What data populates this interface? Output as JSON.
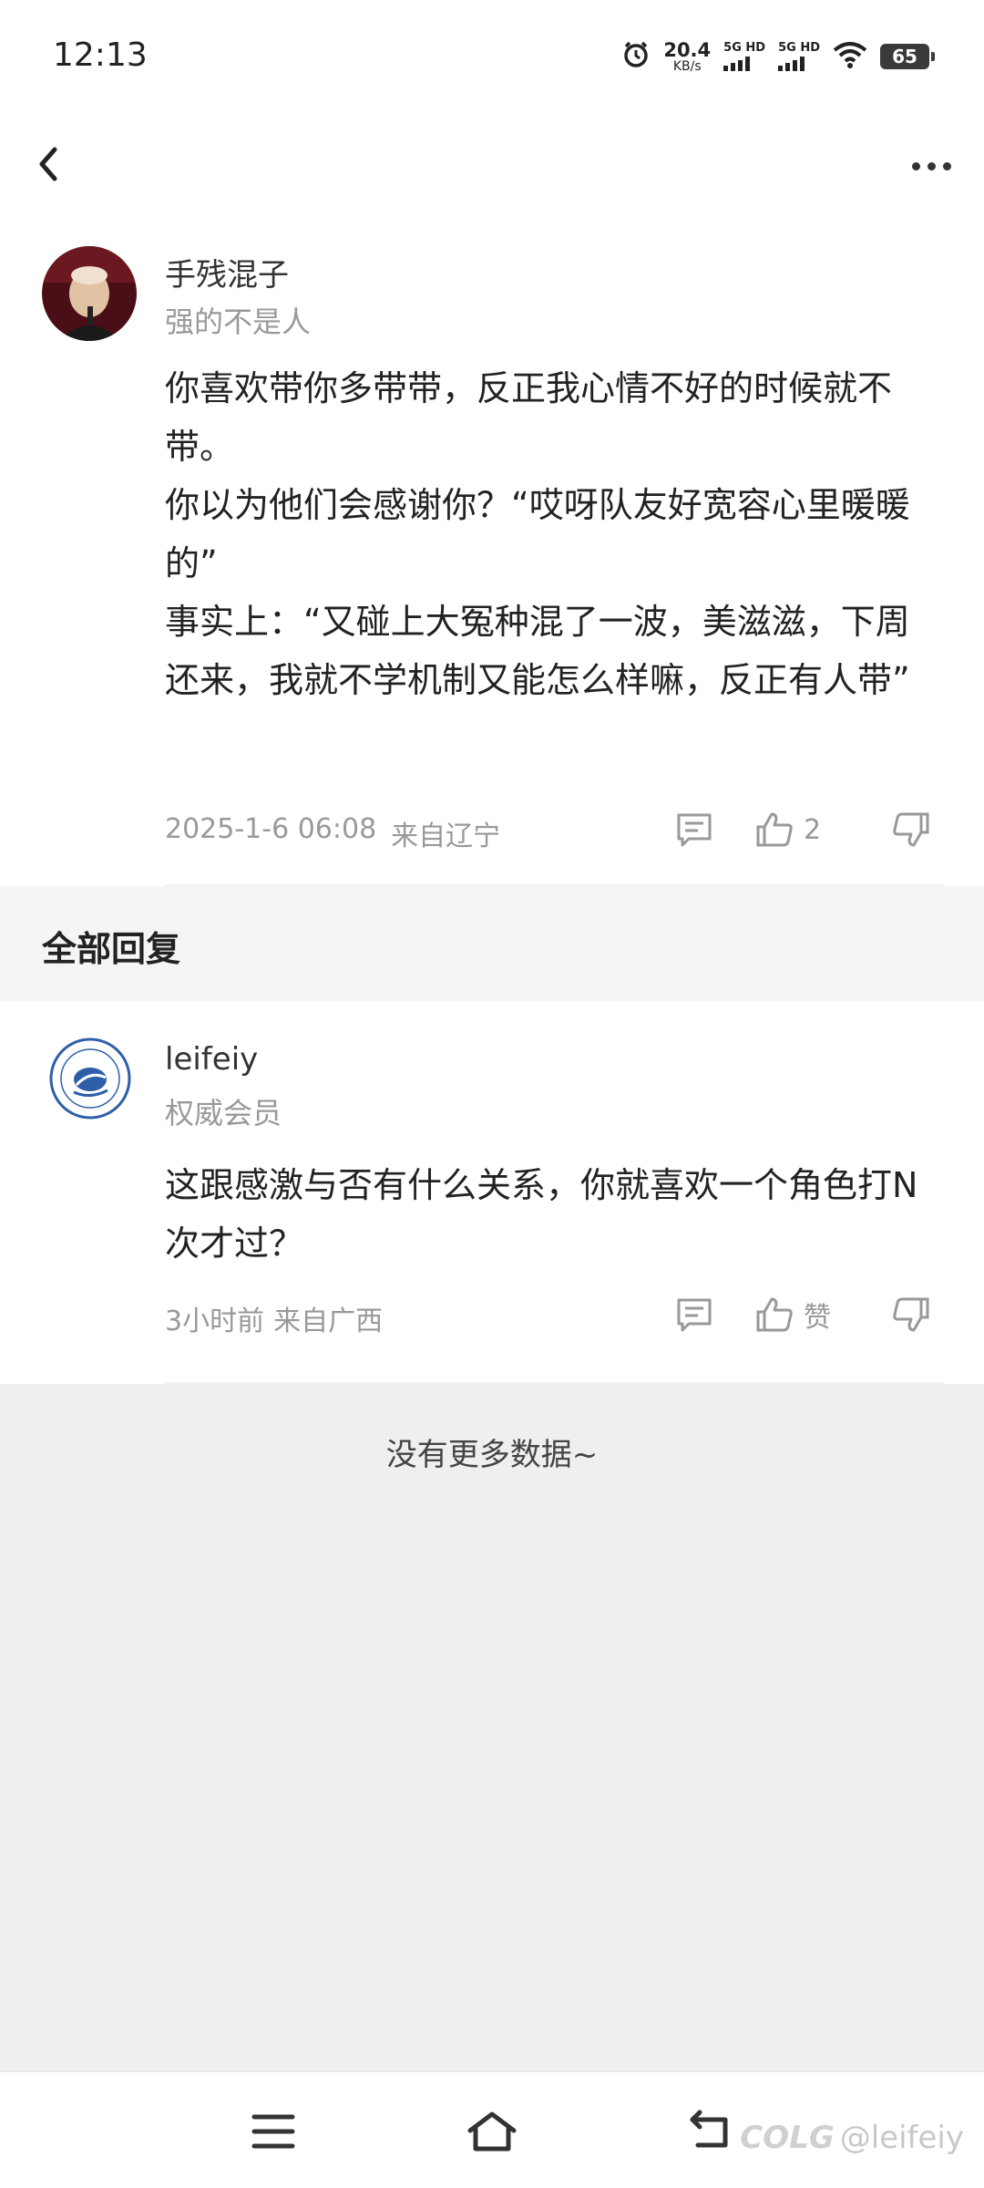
{
  "status_bar": {
    "time": "12:13",
    "net_speed": "20.4",
    "net_unit": "KB/s",
    "sim1": "5G HD",
    "sim2": "5G HD",
    "battery": "65"
  },
  "nav": {
    "back_icon": "chevron-left-icon",
    "more_icon": "more-dots-icon"
  },
  "main_comment": {
    "user_name": "手残混子",
    "user_tag": "强的不是人",
    "paragraphs": [
      "你喜欢带你多带带，反正我心情不好的时候就不带。",
      "你以为他们会感谢你？“哎呀队友好宽容心里暖暖的”",
      "事实上：“又碰上大冤种混了一波，美滋滋，下周还来，我就不学机制又能怎么样嘛，反正有人带”"
    ],
    "date": "2025-1-6 06:08",
    "location": "来自辽宁",
    "like_count": "2"
  },
  "section": {
    "title": "全部回复"
  },
  "reply": {
    "user_name": "leifeiy",
    "user_tag": "权威会员",
    "text": "这跟感激与否有什么关系，你就喜欢一个角色打N次才过？",
    "time": "3小时前",
    "location": "来自广西",
    "like_label": "赞"
  },
  "footer": {
    "no_more": "没有更多数据~"
  },
  "watermark": {
    "logo": "COLG",
    "handle": "@leifeiy"
  },
  "colors": {
    "background": "#efefef",
    "card": "#ffffff",
    "muted_text": "#999999",
    "primary_text": "#222222"
  }
}
